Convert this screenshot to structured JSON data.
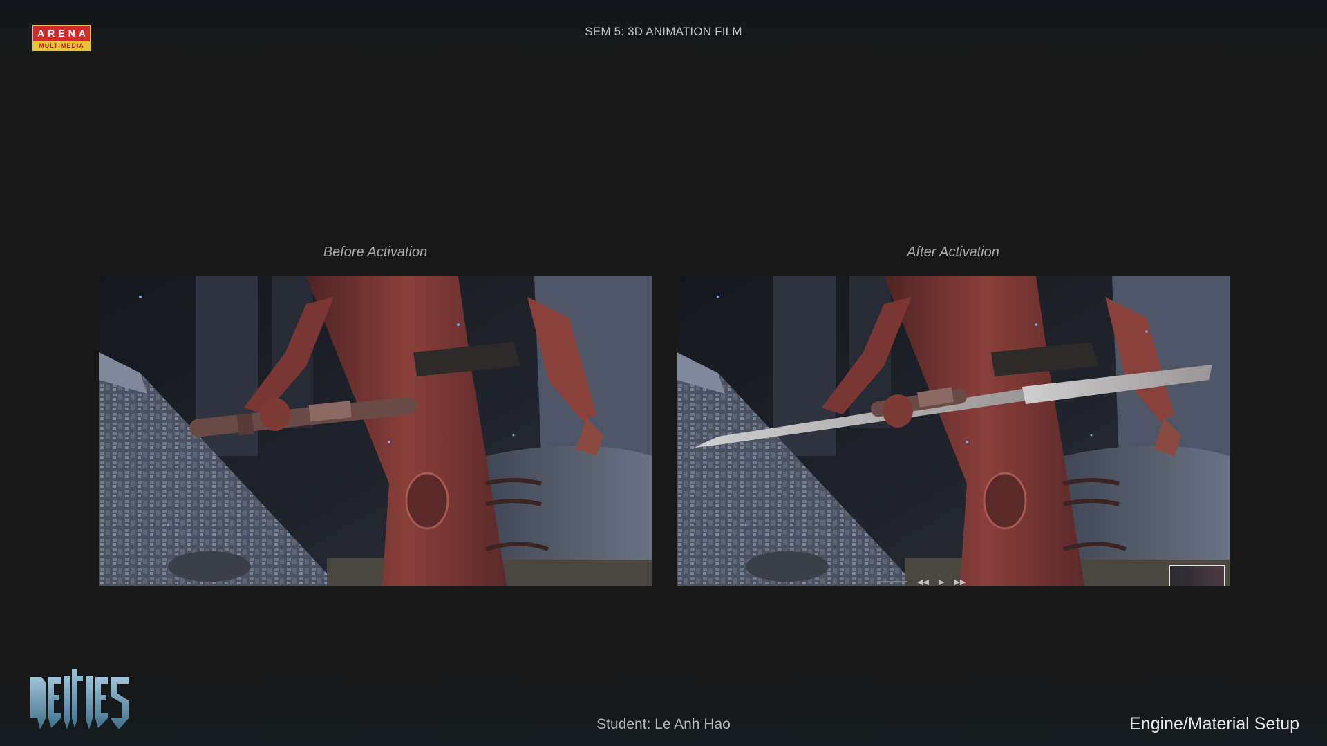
{
  "header": {
    "logo_top": "ARENA",
    "logo_bottom": "MULTIMEDIA",
    "title": "SEM 5: 3D ANIMATION FILM"
  },
  "comparison": {
    "left": {
      "caption": "Before Activation"
    },
    "right": {
      "caption": "After Activation"
    }
  },
  "footer": {
    "student": "Student: Le Anh Hao",
    "section": "Engine/Material Setup",
    "logo_text": "DEITIES"
  },
  "colors": {
    "background": "#181818",
    "arena_red": "#d12a2a",
    "arena_yellow": "#e9c631",
    "character_suit": "#8a3f3a",
    "stone": "#5a6270"
  },
  "icons": {
    "player_controls": [
      "rewind-icon",
      "play-icon",
      "forward-icon"
    ]
  }
}
